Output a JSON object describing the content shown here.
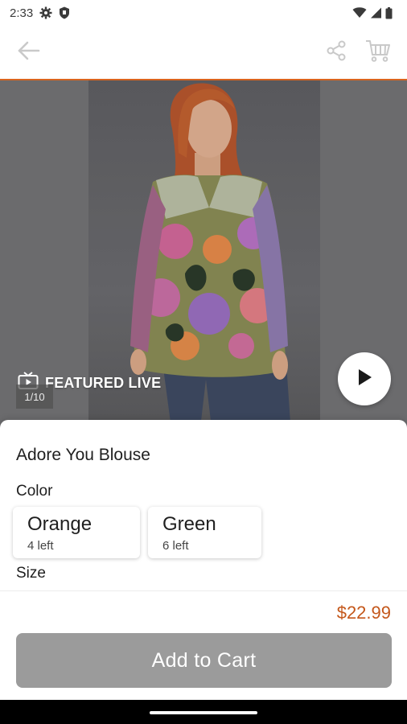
{
  "status_bar": {
    "time": "2:33",
    "icons": [
      "gear-icon",
      "shield-icon",
      "wifi-icon",
      "signal-icon",
      "battery-icon"
    ]
  },
  "top_bar": {
    "icons": [
      "back-arrow-icon",
      "share-icon",
      "cart-icon"
    ]
  },
  "hero": {
    "featured_label": "FEATURED LIVE",
    "image_counter": "1/10",
    "icons": [
      "tv-live-icon",
      "play-icon"
    ]
  },
  "product": {
    "title": "Adore You Blouse",
    "color_label": "Color",
    "colors": [
      {
        "name": "Orange",
        "stock": "4 left"
      },
      {
        "name": "Green",
        "stock": "6 left"
      }
    ],
    "size_label": "Size"
  },
  "checkout": {
    "price": "$22.99",
    "add_to_cart_label": "Add to Cart"
  },
  "colors": {
    "accent": "#d9641f",
    "price": "#c4571a",
    "button_disabled": "#9b9b9b"
  }
}
